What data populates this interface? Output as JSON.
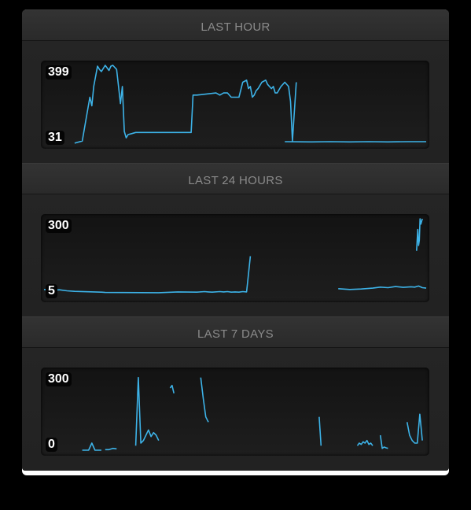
{
  "chart_data": [
    {
      "type": "line",
      "title": "LAST HOUR",
      "ylim": [
        31,
        399
      ],
      "tick_labels": [
        "399",
        "31"
      ],
      "x": [
        0.08,
        0.1,
        0.115,
        0.12,
        0.125,
        0.13,
        0.14,
        0.145,
        0.15,
        0.16,
        0.17,
        0.175,
        0.18,
        0.19,
        0.2,
        0.205,
        0.21,
        0.215,
        0.22,
        0.23,
        0.24,
        0.25,
        0.3,
        0.35,
        0.38,
        0.385,
        0.39,
        0.4,
        0.45,
        0.46,
        0.47,
        0.48,
        0.49,
        0.5,
        0.51,
        0.52,
        0.53,
        0.535,
        0.54,
        0.545,
        0.55,
        0.555,
        0.56,
        0.57,
        0.58,
        0.585,
        0.59,
        0.595,
        0.6,
        0.605,
        0.61,
        0.62,
        0.63,
        0.64,
        0.645,
        0.65,
        0.66
      ],
      "values": [
        35,
        45,
        200,
        250,
        210,
        300,
        395,
        380,
        370,
        399,
        375,
        395,
        399,
        380,
        220,
        300,
        90,
        60,
        75,
        80,
        85,
        85,
        85,
        85,
        85,
        85,
        260,
        260,
        270,
        260,
        270,
        270,
        250,
        250,
        250,
        320,
        330,
        290,
        300,
        250,
        260,
        280,
        290,
        320,
        330,
        310,
        300,
        290,
        300,
        270,
        270,
        300,
        320,
        300,
        230,
        45,
        320
      ],
      "x2": [
        0.63,
        0.7,
        0.75,
        0.8,
        0.85,
        0.9,
        0.95,
        1.0
      ],
      "values2": [
        42,
        41,
        42,
        41,
        42,
        41,
        42,
        42
      ]
    },
    {
      "type": "line",
      "title": "LAST 24 HOURS",
      "ylim": [
        5,
        300
      ],
      "tick_labels": [
        "300",
        "5"
      ],
      "x": [
        0.0,
        0.02,
        0.04,
        0.06,
        0.08,
        0.15,
        0.16,
        0.3,
        0.35,
        0.4,
        0.42,
        0.43,
        0.44,
        0.46,
        0.47,
        0.48,
        0.49,
        0.5,
        0.51,
        0.52,
        0.53,
        0.54
      ],
      "values": [
        35,
        32,
        34,
        30,
        28,
        25,
        24,
        23,
        26,
        25,
        27,
        26,
        25,
        27,
        26,
        27,
        25,
        26,
        25,
        27,
        26,
        160
      ],
      "x2": [
        0.77,
        0.8,
        0.83,
        0.86,
        0.88,
        0.9,
        0.92,
        0.94,
        0.96,
        0.97,
        0.98,
        0.99,
        1.0
      ],
      "values2": [
        38,
        35,
        37,
        40,
        44,
        42,
        46,
        43,
        45,
        44,
        48,
        42,
        40
      ],
      "x3": [
        0.975,
        0.978,
        0.98,
        0.982,
        0.984,
        0.986,
        0.99
      ],
      "values3": [
        180,
        260,
        200,
        220,
        300,
        280,
        300
      ]
    },
    {
      "type": "line",
      "title": "LAST 7 DAYS",
      "ylim": [
        0,
        300
      ],
      "tick_labels": [
        "300",
        "0"
      ],
      "series": [
        {
          "values": [
            3,
            3,
            3,
            30,
            3,
            3,
            3
          ]
        },
        {
          "values": [
            5,
            5,
            10,
            8
          ]
        },
        {
          "values": [
            20,
            280,
            30,
            40,
            60,
            80,
            55,
            70,
            60,
            40
          ]
        },
        {
          "values": [
            240,
            250,
            220
          ]
        },
        {
          "values": [
            280,
            200,
            130,
            110
          ]
        },
        {
          "values": [
            130,
            20
          ]
        },
        {
          "values": [
            20,
            30,
            25,
            35,
            30,
            40,
            25,
            30,
            20
          ]
        },
        {
          "values": [
            60,
            10,
            15,
            12,
            10
          ]
        },
        {
          "values": [
            110,
            60,
            40,
            30,
            30,
            140,
            40
          ]
        }
      ]
    }
  ]
}
